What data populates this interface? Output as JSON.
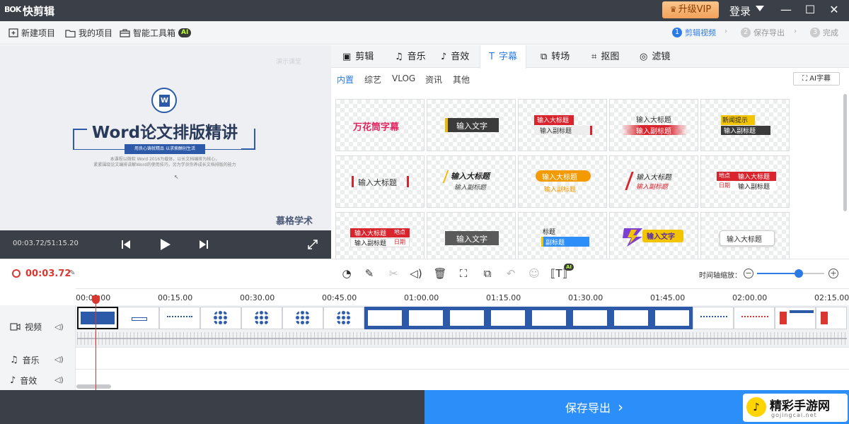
{
  "titlebar": {
    "logo_text": "BOK",
    "app_name": "快剪辑",
    "vip_label": "升级VIP",
    "login_label": "登录",
    "minimize": "—",
    "maximize": "☐",
    "close": "✕"
  },
  "menubar": {
    "items": [
      {
        "label": "新建项目",
        "icon": "add-square-icon"
      },
      {
        "label": "我的项目",
        "icon": "folder-icon"
      },
      {
        "label": "智能工具箱",
        "icon": "toolbox-icon"
      }
    ],
    "ai_badge": "AI",
    "steps": [
      {
        "num": "1",
        "label": "剪辑视频",
        "active": true
      },
      {
        "num": "2",
        "label": "保存导出",
        "active": false
      },
      {
        "num": "3",
        "label": "完成",
        "active": false
      }
    ]
  },
  "preview": {
    "watermark": "演示课堂",
    "word_letter": "W",
    "title": "Word论文排版精讲",
    "tag": "用良心铸就精品 以求索酬创生活",
    "desc_line1": "本课程以微软 Word 2016为载体，以长文档编排为核心，",
    "desc_line2": "紧紧围绕论文编排讲解Word的使用技巧，另为学员你养成长文档排版的能力",
    "brand": "慕格学术",
    "time": "00:03.72/51:15.20"
  },
  "tabs": [
    {
      "label": "剪辑",
      "icon": "video-icon",
      "active": false
    },
    {
      "label": "音乐",
      "icon": "music-icon",
      "active": false
    },
    {
      "label": "音效",
      "icon": "sound-effect-icon",
      "active": false
    },
    {
      "label": "字幕",
      "icon": "text-t-icon",
      "active": true
    },
    {
      "label": "转场",
      "icon": "transition-icon",
      "active": false
    },
    {
      "label": "抠图",
      "icon": "cutout-icon",
      "active": false
    },
    {
      "label": "滤镜",
      "icon": "filter-icon",
      "active": false
    }
  ],
  "subtabs": [
    {
      "label": "内置",
      "active": true
    },
    {
      "label": "综艺",
      "active": false
    },
    {
      "label": "VLOG",
      "active": false
    },
    {
      "label": "资讯",
      "active": false
    },
    {
      "label": "其他",
      "active": false
    }
  ],
  "ai_subtitle_label": "AI字幕",
  "subtitle_styles": [
    {
      "main": "万花筒字幕"
    },
    {
      "main": "输入文字"
    },
    {
      "main": "输入大标题",
      "sub": "输入副标题"
    },
    {
      "main": "输入大标题",
      "sub": "输入副标题"
    },
    {
      "main": "新闻提示",
      "sub": "输入副标题"
    },
    {
      "main": "输入大标题"
    },
    {
      "main": "输入大标题",
      "sub": "输入副标题"
    },
    {
      "main": "输入大标题",
      "sub": "输入副标题"
    },
    {
      "main": "输入大标题",
      "sub": "输入副标题"
    },
    {
      "main": "输入大标题",
      "sub": "输入副标题",
      "tag1": "地点",
      "tag2": "日期"
    },
    {
      "main": "输入大标题",
      "sub": "输入副标题",
      "tag1": "地点",
      "tag2": "日期"
    },
    {
      "main": "输入文字"
    },
    {
      "main": "标题",
      "sub": "副标题"
    },
    {
      "main": "输入文字"
    },
    {
      "main": "输入大标题"
    }
  ],
  "toolbar": {
    "current_time": "00:03.72",
    "zoom_label": "时间轴缩放：",
    "zoom_minus": "−",
    "zoom_plus": "+",
    "zoom_level": 0.62,
    "tools": [
      "speed-icon",
      "pen-icon",
      "scissors-icon",
      "volume-icon",
      "delete-icon",
      "crop-icon",
      "copy-icon",
      "undo-icon",
      "emoji-icon",
      "ai-text-icon"
    ],
    "ai_badge": "AI"
  },
  "timeline": {
    "ticks": [
      "00:00.00",
      "00:15.00",
      "00:30.00",
      "00:45.00",
      "01:00.00",
      "01:15.00",
      "01:30.00",
      "01:45.00",
      "02:00.00",
      "02:15.00"
    ],
    "tracks": [
      {
        "label": "视频",
        "icon": "video-camera-icon"
      },
      {
        "label": "音乐",
        "icon": "music-note-icon"
      },
      {
        "label": "音效",
        "icon": "sound-effect-icon"
      }
    ]
  },
  "bottombar": {
    "export_label": "保存导出",
    "export_arrow": "›",
    "site_name": "精彩手游网",
    "site_url": "gojingcai.net"
  },
  "colors": {
    "accent": "#2c7be5",
    "export": "#2c8ef8",
    "titlebar": "#3b3f48",
    "playhead": "#d9372f"
  }
}
